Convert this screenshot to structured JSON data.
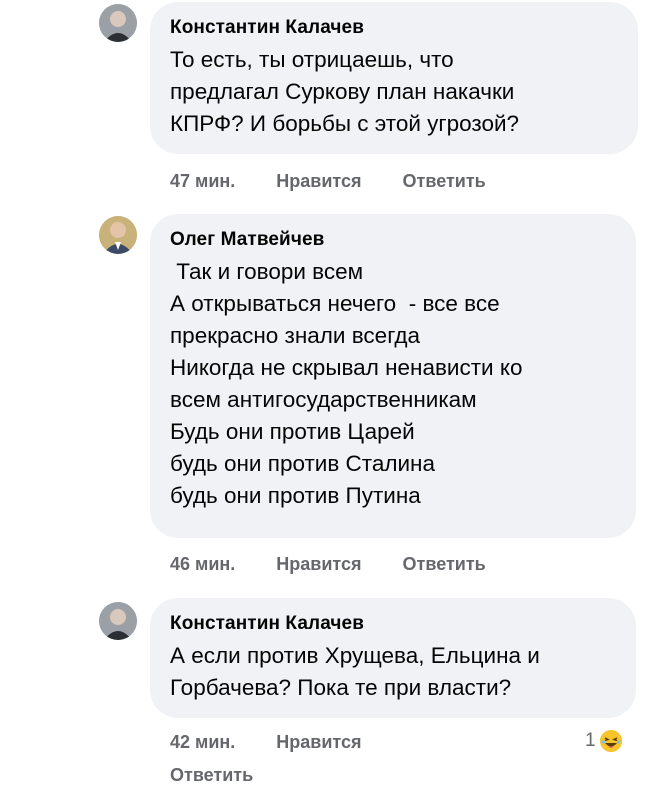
{
  "comments": [
    {
      "author": "Константин Калачев",
      "lines": [
        "То есть, ты отрицаешь, что",
        "предлагал Суркову план накачки",
        "КПРФ? И борьбы с этой угрозой?"
      ],
      "time": "47 мин.",
      "like_label": "Нравится",
      "reply_label": "Ответить"
    },
    {
      "author": "Олег Матвейчев",
      "lines": [
        " Так и говори всем",
        "А открываться нечего  - все все",
        "прекрасно знали всегда",
        "Никогда не скрывал ненависти ко",
        "всем антигосударственникам",
        "Будь они против Царей",
        "будь они против Сталина",
        "будь они против Путина"
      ],
      "time": "46 мин.",
      "like_label": "Нравится",
      "reply_label": "Ответить"
    },
    {
      "author": "Константин Калачев",
      "lines": [
        "А если против Хрущева, Ельцина и",
        "Горбачева? Пока те при власти?"
      ],
      "time": "42 мин.",
      "like_label": "Нравится",
      "reply_label": "Ответить",
      "reaction_count": "1",
      "reaction_icon": "laughing-emoji-icon"
    }
  ]
}
